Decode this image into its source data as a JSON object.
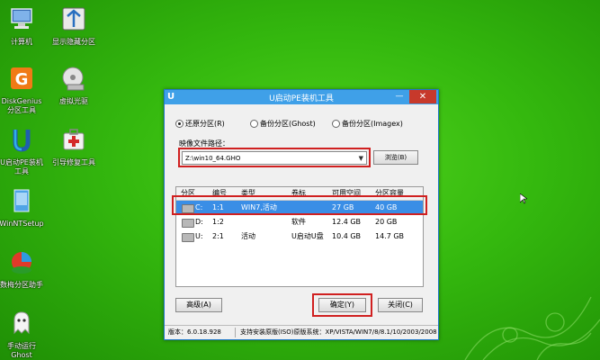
{
  "desktop": {
    "icons": [
      {
        "label": "计算机"
      },
      {
        "label": "显示隐藏分区"
      },
      {
        "label": "DiskGenius\n分区工具"
      },
      {
        "label": "虚拟光驱"
      },
      {
        "label": "U启动PE装机\n工具"
      },
      {
        "label": "引导修复工具"
      },
      {
        "label": "WinNTSetup"
      },
      {
        "label": "数梅分区助手"
      },
      {
        "label": "手动运行\nGhost"
      }
    ]
  },
  "window": {
    "title": "U启动PE装机工具",
    "app_icon_glyph": "U",
    "minimize_glyph": "—",
    "close_glyph": "✕",
    "modes": [
      {
        "label": "还原分区(R)",
        "selected": true
      },
      {
        "label": "备份分区(Ghost)",
        "selected": false
      },
      {
        "label": "备份分区(Imagex)",
        "selected": false
      }
    ],
    "image_path_label": "映像文件路径：",
    "image_path_value": "Z:\\win10_64.GHO",
    "browse_label": "浏览(B)",
    "table": {
      "columns": [
        "分区",
        "编号",
        "类型",
        "卷标",
        "可用空间",
        "分区容量"
      ],
      "rows": [
        {
          "part": "C:",
          "num": "1:1",
          "type": "WIN7,活动",
          "label": "",
          "free": "27 GB",
          "size": "40 GB",
          "selected": true
        },
        {
          "part": "D:",
          "num": "1:2",
          "type": "",
          "label": "软件",
          "free": "12.4 GB",
          "size": "20 GB",
          "selected": false
        },
        {
          "part": "U:",
          "num": "2:1",
          "type": "活动",
          "label": "U启动U盘",
          "free": "10.4 GB",
          "size": "14.7 GB",
          "selected": false
        }
      ]
    },
    "advanced_label": "高级(A)",
    "ok_label": "确定(Y)",
    "close_label": "关闭(C)",
    "status": {
      "version": "版本：6.0.18.928",
      "info": "支持安装原版(ISO)原版系统：XP/VISTA/WIN7/8/8.1/10/2003/2008"
    }
  },
  "colors": {
    "desktop_green": "#34b80e",
    "titlebar_blue": "#3fa0e8",
    "selection_blue": "#3a8ee6",
    "highlight_red": "#d02020",
    "close_red": "#c7392b"
  }
}
